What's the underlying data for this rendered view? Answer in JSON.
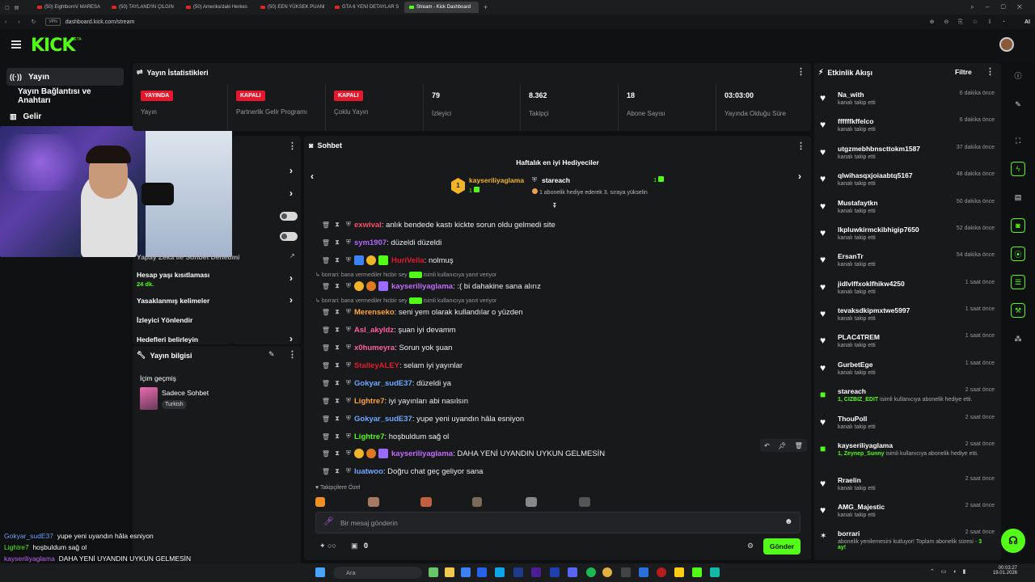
{
  "browser": {
    "tabs": [
      {
        "label": "(50) EightbornV MARESA"
      },
      {
        "label": "(50) TAYLAND'IN ÇILGIN"
      },
      {
        "label": "(50) Amerika'daki Herkes"
      },
      {
        "label": "(50) EEN YÜKSEK PUANI"
      },
      {
        "label": "GTA 6 YENİ DETAYLAR S"
      },
      {
        "label": "Stream - Kick Dashboard"
      }
    ],
    "url": "dashboard.kick.com/stream",
    "url_prefix": "VPN",
    "ai_label": "AI"
  },
  "app": {
    "logo": "KICK",
    "beta": "BETA"
  },
  "sidebar": {
    "items": [
      {
        "label": "Yayın"
      },
      {
        "label": "Yayın Bağlantısı ve Anahtarı"
      },
      {
        "label": "Gelir"
      }
    ]
  },
  "stats": {
    "title": "Yayın İstatistikleri",
    "items": [
      {
        "value": "YAYINDA",
        "label": "Yayın"
      },
      {
        "value": "KAPALI",
        "label": "Partnerlik Gelir Programı"
      },
      {
        "value": "KAPALI",
        "label": "Çoklu Yayın"
      },
      {
        "value": "79",
        "label": "İzleyici"
      },
      {
        "value": "8.362",
        "label": "Takipçi"
      },
      {
        "value": "18",
        "label": "Abone Sayısı"
      },
      {
        "value": "03:03:00",
        "label": "Yayında Olduğu Süre"
      }
    ]
  },
  "settings": {
    "rows": [
      {
        "label": "Yapay Zeka ile Sohbet Denetimi"
      },
      {
        "label": "Hesap yaşı kısıtlaması",
        "sub": "24 dk."
      },
      {
        "label": "Yasaklanmış kelimeler"
      },
      {
        "label": "İzleyici Yönlendir"
      },
      {
        "label": "Hedefleri belirleyin"
      }
    ]
  },
  "stream_info": {
    "title": "Yayın bilgisi",
    "category_label": "İçim geçmiş",
    "category": "Sadece Sohbet",
    "language": "Turkish"
  },
  "chat": {
    "title": "Sohbet",
    "top_gifters_title": "Haftalık en iyi Hediyeciler",
    "gifter1": {
      "rank": "1",
      "name": "kayseriliyaglama",
      "count": "1"
    },
    "gifter2": {
      "name": "stareach",
      "count": "1",
      "note": "1 abonelik hediye ederek 3. sıraya yükselin"
    },
    "messages": [
      {
        "user": "exwival",
        "color": "#ff4d6d",
        "text": ": anlık bendede kastı kickte sorun oldu gelmedi site"
      },
      {
        "user": "sym1907",
        "color": "#b467ff",
        "text": ": düzeldi düzeldi"
      },
      {
        "user": "HuriVella",
        "color": "#e5192d",
        "text": ": nolmuş"
      },
      {
        "reply": "borrari: bana vermediler hicbir sey",
        "reply_tail": "isimli kullanıcıya yanıt veriyor",
        "user": "kayseriliyaglama",
        "color": "#c26bff",
        "text": ": :( bi dahakine sana alırız"
      },
      {
        "reply": "borrari: bana vermediler hicbir sey",
        "reply_tail": "isimli kullanıcıya yanıt veriyor",
        "user": "Merenseko",
        "color": "#ffa43b",
        "text": ": seni yem olarak kullandılar o yüzden"
      },
      {
        "user": "Asl_akyldz",
        "color": "#ff5fa2",
        "text": ": şuan iyi devamm"
      },
      {
        "user": "x0humeyra",
        "color": "#ff5fa2",
        "text": ": Sorun yok şuan"
      },
      {
        "user": "StalleyALEY",
        "color": "#e5192d",
        "text": ": selam iyi yayınlar"
      },
      {
        "user": "Gokyar_sudE37",
        "color": "#6fa8ff",
        "text": ": düzeldi ya"
      },
      {
        "user": "Lightre7",
        "color": "#ffa43b",
        "text": ": iyi yayınları abi nasılsın"
      },
      {
        "user": "Gokyar_sudE37",
        "color": "#6fa8ff",
        "text": ": yupe yeni uyandın hâla esniyon"
      },
      {
        "user": "Lightre7",
        "color": "#53fc18",
        "text": ": hoşbuldum sağ ol"
      },
      {
        "user": "kayseriliyaglama",
        "color": "#c26bff",
        "text": ": DAHA YENİ UYANDIN UYKUN GELMESİN"
      },
      {
        "user": "luatwoo",
        "color": "#6fa8ff",
        "text": ": Doğru chat geç geliyor sana"
      }
    ],
    "followers_label": "Takipçilere Özel",
    "input_placeholder": "Bir mesaj gönderin",
    "points": "0",
    "send_label": "Gönder"
  },
  "activity": {
    "title": "Etkinlik Akışı",
    "filter_label": "Filtre",
    "events": [
      {
        "name": "Na_with",
        "desc": "kanalı takip etti",
        "time": "6 dakika önce",
        "type": "follow"
      },
      {
        "name": "ffffffkffelco",
        "desc": "kanalı takip etti",
        "time": "6 dakika önce",
        "type": "follow"
      },
      {
        "name": "utgzmebhbnscttokm1587",
        "desc": "kanalı takip etti",
        "time": "37 dakika önce",
        "type": "follow"
      },
      {
        "name": "qlwihasqxjoiaabtq5167",
        "desc": "kanalı takip etti",
        "time": "48 dakika önce",
        "type": "follow"
      },
      {
        "name": "Mustafaytkn",
        "desc": "kanalı takip etti",
        "time": "50 dakika önce",
        "type": "follow"
      },
      {
        "name": "lkpluwkirmckibhigip7650",
        "desc": "kanalı takip etti",
        "time": "52 dakika önce",
        "type": "follow"
      },
      {
        "name": "ErsanTr",
        "desc": "kanalı takip etti",
        "time": "54 dakika önce",
        "type": "follow"
      },
      {
        "name": "jidlvlffxoklfhikw4250",
        "desc": "kanalı takip etti",
        "time": "1 saat önce",
        "type": "follow"
      },
      {
        "name": "tevaksdkipmxtwe5997",
        "desc": "kanalı takip etti",
        "time": "1 saat önce",
        "type": "follow"
      },
      {
        "name": "PLAC4TREM",
        "desc": "kanalı takip etti",
        "time": "1 saat önce",
        "type": "follow"
      },
      {
        "name": "GurbetEge",
        "desc": "kanalı takip etti",
        "time": "1 saat önce",
        "type": "follow"
      },
      {
        "name": "stareach",
        "desc_hl": "1, CIZBIZ_EDIT",
        "desc": " isimli kullanıcıya abonelik hediye etti.",
        "time": "2 saat önce",
        "type": "gift"
      },
      {
        "name": "ThouPoll",
        "desc": "kanalı takip etti",
        "time": "2 saat önce",
        "type": "follow"
      },
      {
        "name": "kayseriliyaglama",
        "desc_hl": "1, Zeynep_Sunny",
        "desc": " isimli kullanıcıya abonelik hediye etti.",
        "time": "2 saat önce",
        "type": "gift"
      },
      {
        "name": "Rraelin",
        "desc": "kanalı takip etti",
        "time": "2 saat önce",
        "type": "follow"
      },
      {
        "name": "AMG_Majestic",
        "desc": "kanalı takip etti",
        "time": "2 saat önce",
        "type": "follow"
      },
      {
        "name": "borrari",
        "desc": "abonelik yenilemesini kutluyor! Toplam abonelik süresi - ",
        "desc_hl2": "3 ay!",
        "time": "2 saat önce",
        "type": "resub"
      }
    ]
  },
  "overlay_chat": [
    {
      "user": "Gokyar_sudE37",
      "color": "#6fa8ff",
      "text": "yupe yeni uyandın hâla esniyon"
    },
    {
      "user": "Lightre7",
      "color": "#53fc18",
      "text": "hoşbuldum sağ ol"
    },
    {
      "user": "kayseriliyaglama",
      "color": "#c26bff",
      "text": "DAHA YENİ UYANDIN UYKUN GELMESİN"
    },
    {
      "user": "luatwoo",
      "color": "#6fa8ff",
      "text": "Doğru chat geç geliyor sana"
    }
  ],
  "taskbar": {
    "search": "Ara",
    "time": "00:03:27",
    "date": "19.01.2026"
  },
  "colors": {
    "accent": "#53fc18",
    "live": "#e5192d",
    "panel": "#18191b",
    "bg": "#0f1011"
  }
}
